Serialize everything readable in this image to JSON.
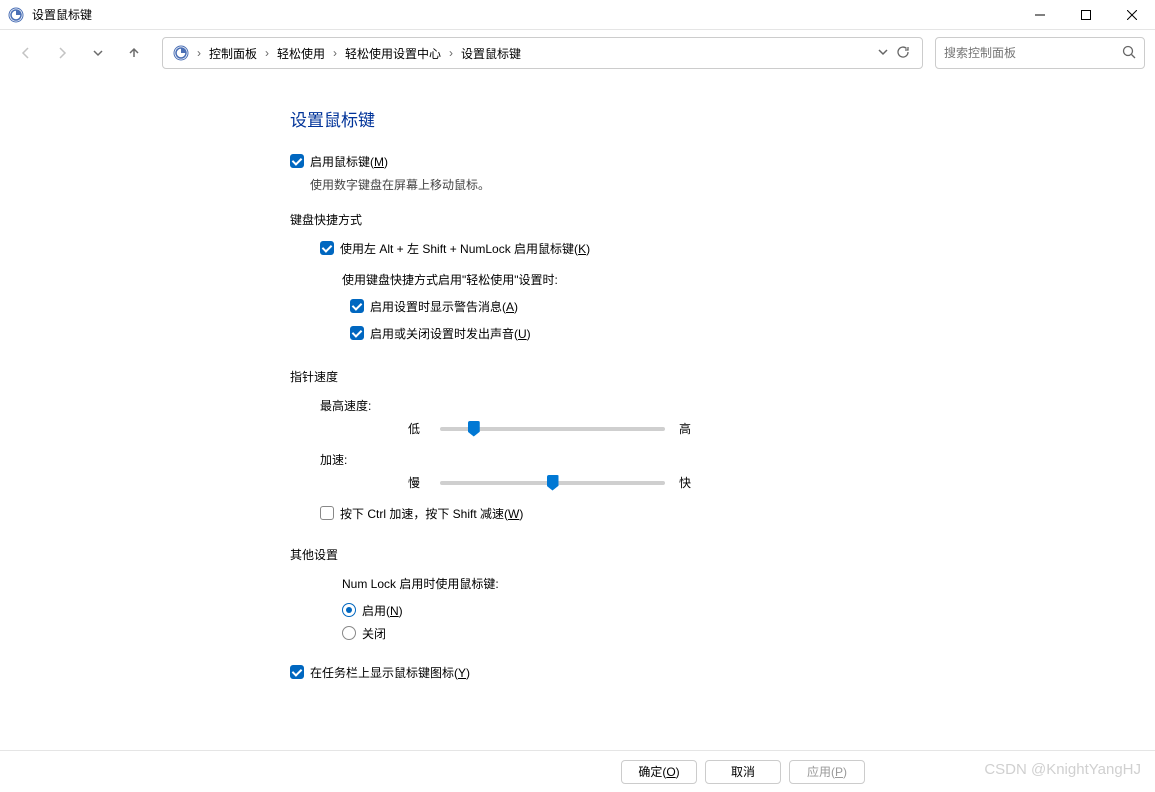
{
  "window": {
    "title": "设置鼠标键"
  },
  "breadcrumbs": {
    "b1": "控制面板",
    "b2": "轻松使用",
    "b3": "轻松使用设置中心",
    "b4": "设置鼠标键"
  },
  "search": {
    "placeholder": "搜索控制面板"
  },
  "page": {
    "heading": "设置鼠标键",
    "enable_mousekeys": {
      "label_pre": "启用鼠标键(",
      "hotkey": "M",
      "label_post": ")",
      "checked": true
    },
    "enable_desc": "使用数字键盘在屏幕上移动鼠标。",
    "group_shortcut": "键盘快捷方式",
    "shortcut_enable": {
      "label_pre": "使用左 Alt + 左 Shift + NumLock 启用鼠标键(",
      "hotkey": "K",
      "label_post": ")",
      "checked": true
    },
    "shortcut_desc": "使用键盘快捷方式启用\"轻松使用\"设置时:",
    "warn_msg": {
      "label_pre": "启用设置时显示警告消息(",
      "hotkey": "A",
      "label_post": ")",
      "checked": true
    },
    "play_sound": {
      "label_pre": "启用或关闭设置时发出声音(",
      "hotkey": "U",
      "label_post": ")",
      "checked": true
    },
    "group_speed": "指针速度",
    "speed_max_label": "最高速度:",
    "speed_low": "低",
    "speed_high": "高",
    "speed_max_value": 15,
    "accel_label": "加速:",
    "accel_slow": "慢",
    "accel_fast": "快",
    "accel_value": 50,
    "ctrl_shift": {
      "label_pre": "按下 Ctrl 加速，按下 Shift 减速(",
      "hotkey": "W",
      "label_post": ")",
      "checked": false
    },
    "group_other": "其他设置",
    "numlock_label": "Num Lock 启用时使用鼠标键:",
    "radio_on": {
      "label_pre": "启用(",
      "hotkey": "N",
      "label_post": ")",
      "checked": true
    },
    "radio_off": {
      "label": "关闭",
      "checked": false
    },
    "show_tray": {
      "label_pre": "在任务栏上显示鼠标键图标(",
      "hotkey": "Y",
      "label_post": ")",
      "checked": true
    }
  },
  "buttons": {
    "ok_pre": "确定(",
    "ok_key": "O",
    "ok_post": ")",
    "cancel": "取消",
    "apply_pre": "应用(",
    "apply_key": "P",
    "apply_post": ")"
  },
  "watermark": "CSDN @KnightYangHJ"
}
